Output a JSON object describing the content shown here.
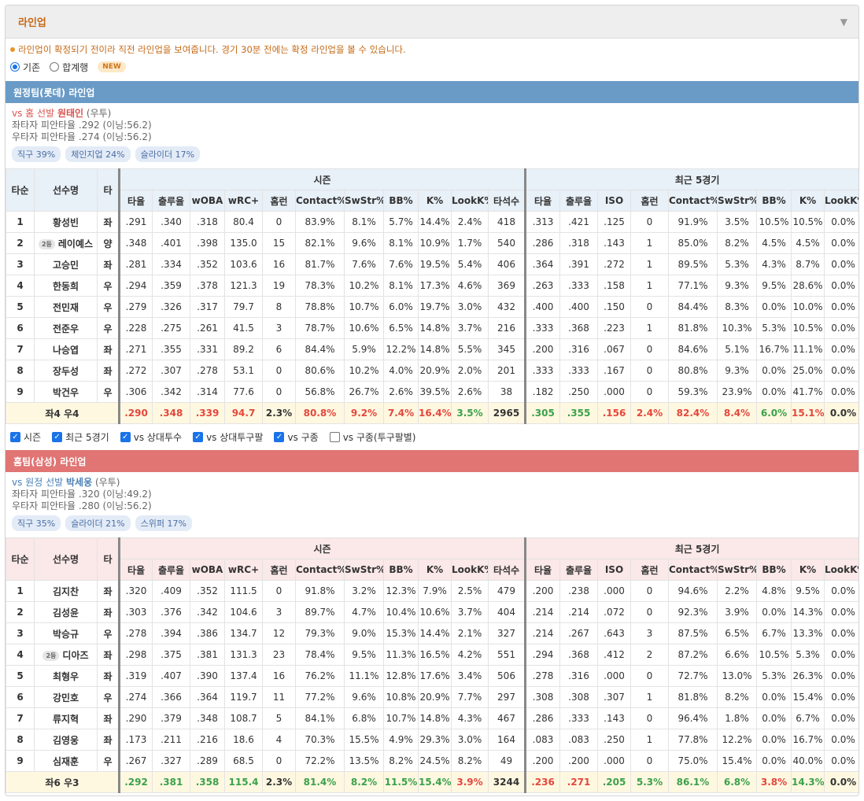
{
  "panel": {
    "title": "라인업",
    "toggle_icon": "triangle-down"
  },
  "notice": "라인업이 확정되기 전이라 직전 라인업을 보여줍니다. 경기 30분 전에는 확정 라인업을 볼 수 있습니다.",
  "view_mode": {
    "options": [
      "기존",
      "합계행"
    ],
    "selected": "기존",
    "new_badge": "NEW"
  },
  "column_groups": {
    "season": "시즌",
    "recent": "최근 5경기"
  },
  "columns": {
    "fixed": [
      "타순",
      "선수명",
      "타"
    ],
    "season": [
      "타율",
      "출루율",
      "wOBA",
      "wRC+",
      "홈런",
      "Contact%",
      "SwStr%",
      "BB%",
      "K%",
      "LookK%",
      "타석수"
    ],
    "recent": [
      "타율",
      "출루율",
      "ISO",
      "홈런",
      "Contact%",
      "SwStr%",
      "BB%",
      "K%",
      "LookK%"
    ]
  },
  "filters": [
    {
      "label": "시즌",
      "checked": true
    },
    {
      "label": "최근 5경기",
      "checked": true
    },
    {
      "label": "vs 상대투수",
      "checked": true
    },
    {
      "label": "vs 상대투구팔",
      "checked": true
    },
    {
      "label": "vs 구종",
      "checked": true
    },
    {
      "label": "vs 구종(투구팔별)",
      "checked": false
    }
  ],
  "away": {
    "section_title": "원정팀(롯데) 라인업",
    "vs_prefix": "vs 홈 선발",
    "pitcher": "원태인",
    "pitcher_hand": "(우투)",
    "split_left": "좌타자 피안타율 .292 (이닝:56.2)",
    "split_right": "우타자 피안타율 .274 (이닝:56.2)",
    "pitch_mix": [
      "직구 39%",
      "체인지업 24%",
      "슬라이더 17%"
    ],
    "players": [
      {
        "order": "1",
        "name": "황성빈",
        "badge": "",
        "hand": "좌",
        "season": [
          ".291",
          ".340",
          ".318",
          "80.4",
          "0",
          "83.9%",
          "8.1%",
          "5.7%",
          "14.4%",
          "2.4%",
          "418"
        ],
        "recent": [
          ".313",
          ".421",
          ".125",
          "0",
          "91.9%",
          "3.5%",
          "10.5%",
          "10.5%",
          "0.0%"
        ]
      },
      {
        "order": "2",
        "name": "레이예스",
        "badge": "2등",
        "hand": "양",
        "season": [
          ".348",
          ".401",
          ".398",
          "135.0",
          "15",
          "82.1%",
          "9.6%",
          "8.1%",
          "10.9%",
          "1.7%",
          "540"
        ],
        "recent": [
          ".286",
          ".318",
          ".143",
          "1",
          "85.0%",
          "8.2%",
          "4.5%",
          "4.5%",
          "0.0%"
        ]
      },
      {
        "order": "3",
        "name": "고승민",
        "badge": "",
        "hand": "좌",
        "season": [
          ".281",
          ".334",
          ".352",
          "103.6",
          "16",
          "81.7%",
          "7.6%",
          "7.6%",
          "19.5%",
          "5.4%",
          "406"
        ],
        "recent": [
          ".364",
          ".391",
          ".272",
          "1",
          "89.5%",
          "5.3%",
          "4.3%",
          "8.7%",
          "0.0%"
        ]
      },
      {
        "order": "4",
        "name": "한동희",
        "badge": "",
        "hand": "우",
        "season": [
          ".294",
          ".359",
          ".378",
          "121.3",
          "19",
          "78.3%",
          "10.2%",
          "8.1%",
          "17.3%",
          "4.6%",
          "369"
        ],
        "recent": [
          ".263",
          ".333",
          ".158",
          "1",
          "77.1%",
          "9.3%",
          "9.5%",
          "28.6%",
          "0.0%"
        ]
      },
      {
        "order": "5",
        "name": "전민재",
        "badge": "",
        "hand": "우",
        "season": [
          ".279",
          ".326",
          ".317",
          "79.7",
          "8",
          "78.8%",
          "10.7%",
          "6.0%",
          "19.7%",
          "3.0%",
          "432"
        ],
        "recent": [
          ".400",
          ".400",
          ".150",
          "0",
          "84.4%",
          "8.3%",
          "0.0%",
          "10.0%",
          "0.0%"
        ]
      },
      {
        "order": "6",
        "name": "전준우",
        "badge": "",
        "hand": "우",
        "season": [
          ".228",
          ".275",
          ".261",
          "41.5",
          "3",
          "78.7%",
          "10.6%",
          "6.5%",
          "14.8%",
          "3.7%",
          "216"
        ],
        "recent": [
          ".333",
          ".368",
          ".223",
          "1",
          "81.8%",
          "10.3%",
          "5.3%",
          "10.5%",
          "0.0%"
        ]
      },
      {
        "order": "7",
        "name": "나승엽",
        "badge": "",
        "hand": "좌",
        "season": [
          ".271",
          ".355",
          ".331",
          "89.2",
          "6",
          "84.4%",
          "5.9%",
          "12.2%",
          "14.8%",
          "5.5%",
          "345"
        ],
        "recent": [
          ".200",
          ".316",
          ".067",
          "0",
          "84.6%",
          "5.1%",
          "16.7%",
          "11.1%",
          "0.0%"
        ]
      },
      {
        "order": "8",
        "name": "장두성",
        "badge": "",
        "hand": "좌",
        "season": [
          ".272",
          ".307",
          ".278",
          "53.1",
          "0",
          "80.6%",
          "10.2%",
          "4.0%",
          "20.9%",
          "2.0%",
          "201"
        ],
        "recent": [
          ".333",
          ".333",
          ".167",
          "0",
          "80.8%",
          "9.3%",
          "0.0%",
          "25.0%",
          "0.0%"
        ]
      },
      {
        "order": "9",
        "name": "박건우",
        "badge": "",
        "hand": "우",
        "season": [
          ".306",
          ".342",
          ".314",
          "77.6",
          "0",
          "56.8%",
          "26.7%",
          "2.6%",
          "39.5%",
          "2.6%",
          "38"
        ],
        "recent": [
          ".182",
          ".250",
          ".000",
          "0",
          "59.3%",
          "23.9%",
          "0.0%",
          "41.7%",
          "0.0%"
        ]
      }
    ],
    "total": {
      "label": "좌4 우4",
      "season": [
        ".290",
        ".348",
        ".339",
        "94.7",
        "2.3%",
        "80.8%",
        "9.2%",
        "7.4%",
        "16.4%",
        "3.5%",
        "2965"
      ],
      "season_tone": [
        "bad",
        "bad",
        "bad",
        "bad",
        "",
        "bad",
        "bad",
        "bad",
        "bad",
        "good",
        ""
      ],
      "recent": [
        ".305",
        ".355",
        ".156",
        "2.4%",
        "82.4%",
        "8.4%",
        "6.0%",
        "15.1%",
        "0.0%"
      ],
      "recent_tone": [
        "good",
        "good",
        "bad",
        "bad",
        "bad",
        "bad",
        "good",
        "bad",
        ""
      ]
    }
  },
  "home": {
    "section_title": "홈팀(삼성) 라인업",
    "vs_prefix": "vs 원정 선발",
    "pitcher": "박세웅",
    "pitcher_hand": "(우투)",
    "split_left": "좌타자 피안타율 .320 (이닝:49.2)",
    "split_right": "우타자 피안타율 .280 (이닝:56.2)",
    "pitch_mix": [
      "직구 35%",
      "슬라이더 21%",
      "스위퍼 17%"
    ],
    "players": [
      {
        "order": "1",
        "name": "김지찬",
        "badge": "",
        "hand": "좌",
        "season": [
          ".320",
          ".409",
          ".352",
          "111.5",
          "0",
          "91.8%",
          "3.2%",
          "12.3%",
          "7.9%",
          "2.5%",
          "479"
        ],
        "recent": [
          ".200",
          ".238",
          ".000",
          "0",
          "94.6%",
          "2.2%",
          "4.8%",
          "9.5%",
          "0.0%"
        ]
      },
      {
        "order": "2",
        "name": "김성윤",
        "badge": "",
        "hand": "좌",
        "season": [
          ".303",
          ".376",
          ".342",
          "104.6",
          "3",
          "89.7%",
          "4.7%",
          "10.4%",
          "10.6%",
          "3.7%",
          "404"
        ],
        "recent": [
          ".214",
          ".214",
          ".072",
          "0",
          "92.3%",
          "3.9%",
          "0.0%",
          "14.3%",
          "0.0%"
        ]
      },
      {
        "order": "3",
        "name": "박승규",
        "badge": "",
        "hand": "우",
        "season": [
          ".278",
          ".394",
          ".386",
          "134.7",
          "12",
          "79.3%",
          "9.0%",
          "15.3%",
          "14.4%",
          "2.1%",
          "327"
        ],
        "recent": [
          ".214",
          ".267",
          ".643",
          "3",
          "87.5%",
          "6.5%",
          "6.7%",
          "13.3%",
          "0.0%"
        ]
      },
      {
        "order": "4",
        "name": "디아즈",
        "badge": "2등",
        "hand": "좌",
        "season": [
          ".298",
          ".375",
          ".381",
          "131.3",
          "23",
          "78.4%",
          "9.5%",
          "11.3%",
          "16.5%",
          "4.2%",
          "551"
        ],
        "recent": [
          ".294",
          ".368",
          ".412",
          "2",
          "87.2%",
          "6.6%",
          "10.5%",
          "5.3%",
          "0.0%"
        ]
      },
      {
        "order": "5",
        "name": "최형우",
        "badge": "",
        "hand": "좌",
        "season": [
          ".319",
          ".407",
          ".390",
          "137.4",
          "16",
          "76.2%",
          "11.1%",
          "12.8%",
          "17.6%",
          "3.4%",
          "506"
        ],
        "recent": [
          ".278",
          ".316",
          ".000",
          "0",
          "72.7%",
          "13.0%",
          "5.3%",
          "26.3%",
          "0.0%"
        ]
      },
      {
        "order": "6",
        "name": "강민호",
        "badge": "",
        "hand": "우",
        "season": [
          ".274",
          ".366",
          ".364",
          "119.7",
          "11",
          "77.2%",
          "9.6%",
          "10.8%",
          "20.9%",
          "7.7%",
          "297"
        ],
        "recent": [
          ".308",
          ".308",
          ".307",
          "1",
          "81.8%",
          "8.2%",
          "0.0%",
          "15.4%",
          "0.0%"
        ]
      },
      {
        "order": "7",
        "name": "류지혁",
        "badge": "",
        "hand": "좌",
        "season": [
          ".290",
          ".379",
          ".348",
          "108.7",
          "5",
          "84.1%",
          "6.8%",
          "10.7%",
          "14.8%",
          "4.3%",
          "467"
        ],
        "recent": [
          ".286",
          ".333",
          ".143",
          "0",
          "96.4%",
          "1.8%",
          "0.0%",
          "6.7%",
          "0.0%"
        ]
      },
      {
        "order": "8",
        "name": "김영웅",
        "badge": "",
        "hand": "좌",
        "season": [
          ".173",
          ".211",
          ".216",
          "18.6",
          "4",
          "70.3%",
          "15.5%",
          "4.9%",
          "29.3%",
          "3.0%",
          "164"
        ],
        "recent": [
          ".083",
          ".083",
          ".250",
          "1",
          "77.8%",
          "12.2%",
          "0.0%",
          "16.7%",
          "0.0%"
        ]
      },
      {
        "order": "9",
        "name": "심재훈",
        "badge": "",
        "hand": "우",
        "season": [
          ".267",
          ".327",
          ".289",
          "68.5",
          "0",
          "72.2%",
          "13.5%",
          "8.2%",
          "24.5%",
          "8.2%",
          "49"
        ],
        "recent": [
          ".200",
          ".200",
          ".000",
          "0",
          "75.0%",
          "15.4%",
          "0.0%",
          "40.0%",
          "0.0%"
        ]
      }
    ],
    "total": {
      "label": "좌6 우3",
      "season": [
        ".292",
        ".381",
        ".358",
        "115.4",
        "2.3%",
        "81.4%",
        "8.2%",
        "11.5%",
        "15.4%",
        "3.9%",
        "3244"
      ],
      "season_tone": [
        "good",
        "good",
        "good",
        "good",
        "",
        "good",
        "good",
        "good",
        "good",
        "bad",
        ""
      ],
      "recent": [
        ".236",
        ".271",
        ".205",
        "5.3%",
        "86.1%",
        "6.8%",
        "3.8%",
        "14.3%",
        "0.0%"
      ],
      "recent_tone": [
        "bad",
        "bad",
        "good",
        "good",
        "good",
        "good",
        "bad",
        "good",
        ""
      ]
    }
  }
}
